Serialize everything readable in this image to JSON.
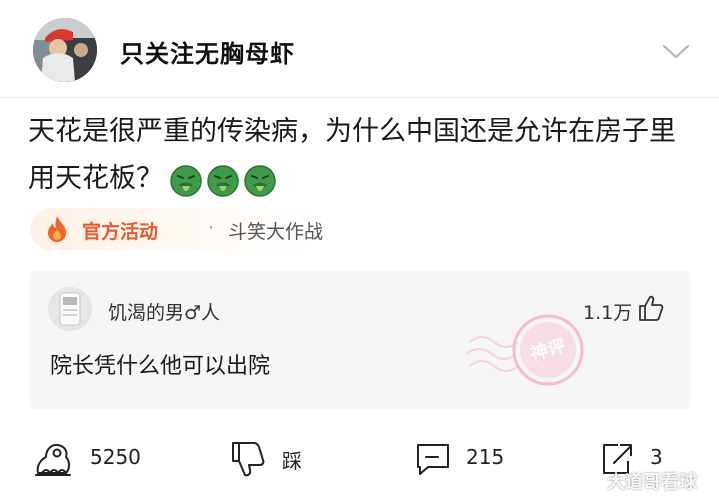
{
  "header": {
    "username": "只关注无胸母虾",
    "avatar_label": "avatar",
    "chevron_icon": "chevron-down-icon"
  },
  "post": {
    "text": "天花是很严重的传染病，为什么中国还是允许在房子里用天花板？",
    "emoji_icon": "vomit-face-icon",
    "emoji_count": 3
  },
  "tag": {
    "label": "官方活动",
    "separator": "·",
    "topic": "斗笑大作战",
    "color": "#e8592b"
  },
  "top_comment": {
    "username": "饥渴的男♂人",
    "likes": "1.1万",
    "text": "院长凭什么他可以出院",
    "badge_icon": "shenping-stamp-icon"
  },
  "actions": {
    "repost_count": "5250",
    "dislike_label": "踩",
    "comment_count": "215",
    "share_count": "3"
  },
  "watermark": "大道哥看球"
}
